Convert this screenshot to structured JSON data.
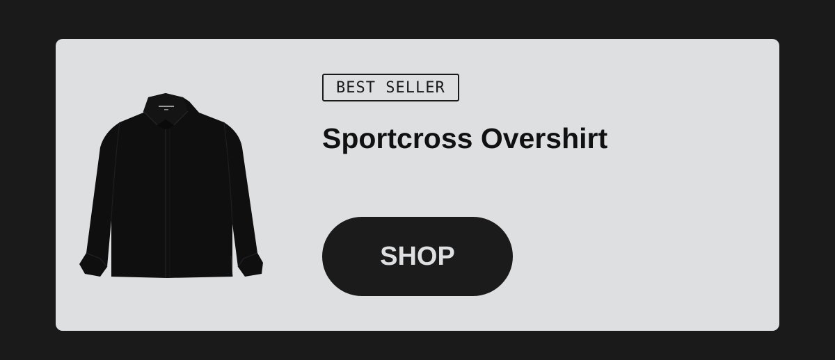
{
  "promo": {
    "badge": "BEST SELLER",
    "product_name": "Sportcross Overshirt",
    "shop_label": "SHOP"
  },
  "product_image": {
    "icon": "overshirt-product-photo"
  },
  "colors": {
    "page_background": "#1a1a1a",
    "card_background": "#dedfe0",
    "button_background": "#1b1b1b",
    "button_text": "#dedfe0",
    "text": "#111111"
  }
}
